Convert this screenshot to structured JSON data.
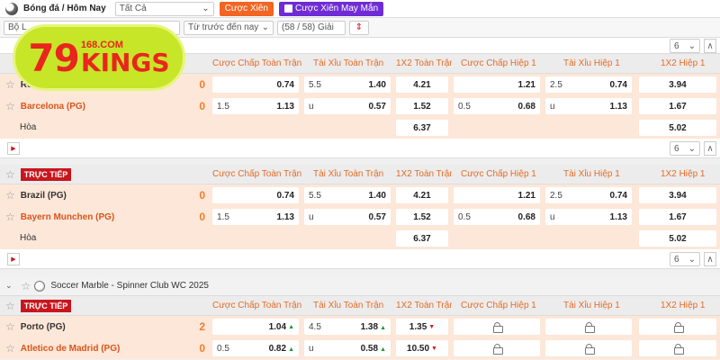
{
  "toolbar": {
    "title": "Bóng đá / Hôm Nay",
    "sport_select": "Tất Cả",
    "btn_parlay": "Cược Xiên",
    "btn_lucky_parlay": "Cược Xiên May Mắn"
  },
  "filters": {
    "market": "Bộ L",
    "time": "Từ trước đến nay",
    "leagues": "(58 / 58) Giải"
  },
  "logo": {
    "number": "79",
    "site": "168.COM",
    "brand": "KINGS"
  },
  "columns": [
    "Cược Chấp Toàn Trận",
    "Tài Xỉu Toàn Trận",
    "1X2 Toàn Trận",
    "Cược Chấp Hiệp 1",
    "Tài Xỉu Hiệp 1",
    "1X2 Hiệp 1"
  ],
  "live_label": "TRỰC TIẾP",
  "draw_label": "Hòa",
  "pager_value": "6",
  "matches": [
    {
      "home": "Real Madrid (PG)",
      "away": "Barcelona (PG)",
      "home_score": "0",
      "away_score": "0",
      "home_odds": {
        "ft_hdp_line": "",
        "ft_hdp": "0.74",
        "ft_ou_line": "5.5",
        "ft_ou": "1.40",
        "ft_1x2": "4.21",
        "h1_hdp_line": "",
        "h1_hdp": "1.21",
        "h1_ou_line": "2.5",
        "h1_ou": "0.74",
        "h1_1x2": "3.94"
      },
      "away_odds": {
        "ft_hdp_line": "1.5",
        "ft_hdp": "1.13",
        "ft_ou_line": "u",
        "ft_ou": "0.57",
        "ft_1x2": "1.52",
        "h1_hdp_line": "0.5",
        "h1_hdp": "0.68",
        "h1_ou_line": "u",
        "h1_ou": "1.13",
        "h1_1x2": "1.67"
      },
      "draw_ft": "6.37",
      "draw_h1": "5.02"
    },
    {
      "home": "Brazil (PG)",
      "away": "Bayern Munchen (PG)",
      "home_score": "0",
      "away_score": "0",
      "home_odds": {
        "ft_hdp_line": "",
        "ft_hdp": "0.74",
        "ft_ou_line": "5.5",
        "ft_ou": "1.40",
        "ft_1x2": "4.21",
        "h1_hdp_line": "",
        "h1_hdp": "1.21",
        "h1_ou_line": "2.5",
        "h1_ou": "0.74",
        "h1_1x2": "3.94"
      },
      "away_odds": {
        "ft_hdp_line": "1.5",
        "ft_hdp": "1.13",
        "ft_ou_line": "u",
        "ft_ou": "0.57",
        "ft_1x2": "1.52",
        "h1_hdp_line": "0.5",
        "h1_hdp": "0.68",
        "h1_ou_line": "u",
        "h1_ou": "1.13",
        "h1_1x2": "1.67"
      },
      "draw_ft": "6.37",
      "draw_h1": "5.02"
    }
  ],
  "league3": {
    "name": "Soccer Marble - Spinner Club WC 2025",
    "home": "Porto (PG)",
    "away": "Atletico de Madrid (PG)",
    "home_score": "2",
    "away_score": "0",
    "home_hdp": "1.04",
    "home_ou_line": "4.5",
    "home_ou": "1.38",
    "home_1x2": "1.35",
    "away_hdp_line": "0.5",
    "away_hdp": "0.82",
    "away_ou_line": "u",
    "away_ou": "0.58",
    "away_1x2": "10.50"
  },
  "colors": {
    "accent": "#f26522",
    "live": "#c8161d",
    "row_bg": "#fde7d8",
    "parlay_purple": "#6f2cd6"
  }
}
